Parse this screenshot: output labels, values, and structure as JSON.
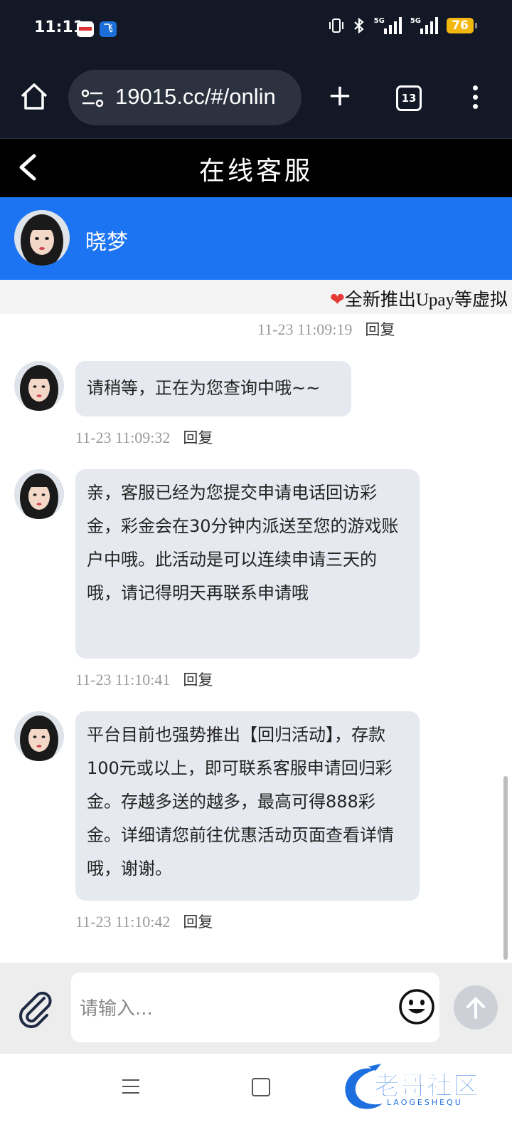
{
  "status_bar": {
    "time": "11:11",
    "network_labels": [
      "5G",
      "5G"
    ],
    "battery": "76"
  },
  "browser": {
    "url": "19015.cc/#/onlin",
    "tab_count": "13"
  },
  "header": {
    "title": "在线客服"
  },
  "agent": {
    "name": "晓梦"
  },
  "marquee": {
    "text": "全新推出Upay等虚拟"
  },
  "messages": [
    {
      "text": "",
      "time": "11-23 11:09:19",
      "reply": "回复"
    },
    {
      "text": "请稍等，正在为您查询中哦~~",
      "time": "11-23 11:09:32",
      "reply": "回复"
    },
    {
      "text": "亲，客服已经为您提交申请电话回访彩金，彩金会在30分钟内派送至您的游戏账户中哦。此活动是可以连续申请三天的哦，请记得明天再联系申请哦",
      "time": "11-23 11:10:41",
      "reply": "回复"
    },
    {
      "text": "平台目前也强势推出【回归活动】，存款100元或以上，即可联系客服申请回归彩金。存越多送的越多，最高可得888彩金。详细请您前往优惠活动页面查看详情哦，谢谢。",
      "time": "11-23 11:10:42",
      "reply": "回复"
    }
  ],
  "input": {
    "placeholder": "请输入..."
  },
  "watermark": {
    "title": "老哥社区",
    "subtitle": "LAOGESHEQU"
  },
  "colors": {
    "agent_bar": "#1c74f3",
    "header": "#000000",
    "browser": "#121826",
    "bubble": "#e6e9ef"
  }
}
